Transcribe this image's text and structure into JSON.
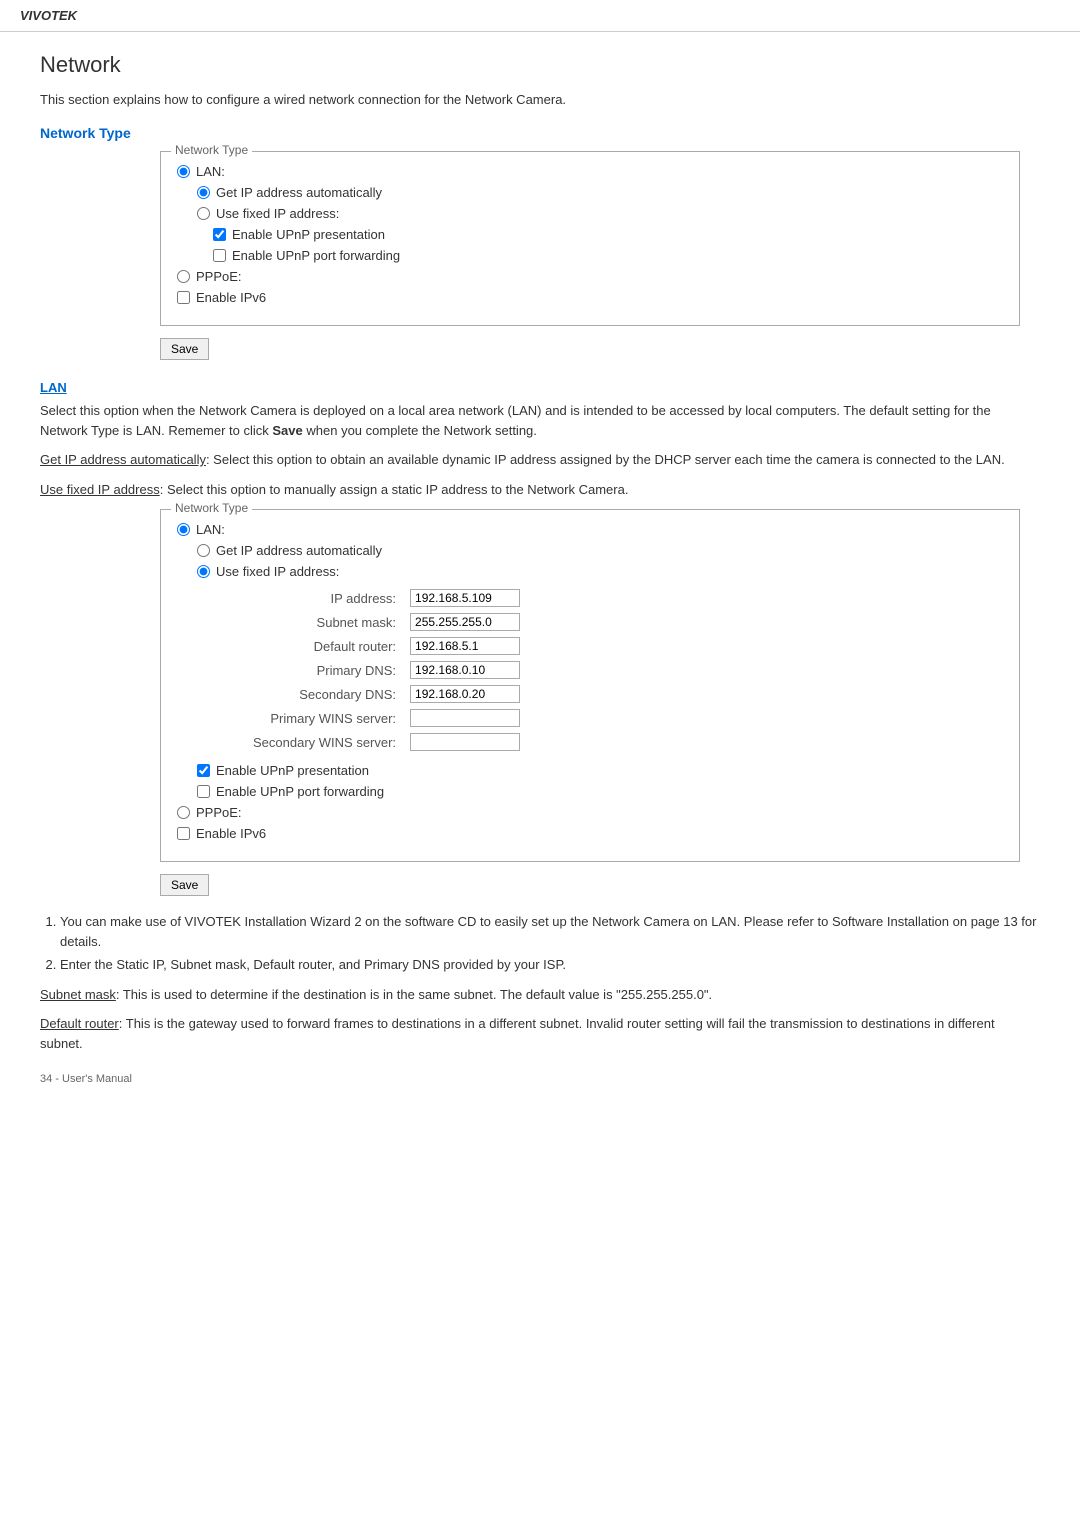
{
  "brand": "VIVOTEK",
  "page": {
    "title": "Network",
    "intro": "This section explains how to configure a wired network connection for the Network Camera."
  },
  "network_type_section": {
    "heading": "Network Type",
    "box_title": "Network Type",
    "box1": {
      "lan_label": "LAN:",
      "get_ip_auto_label": "Get IP address automatically",
      "use_fixed_ip_label": "Use fixed IP address:",
      "enable_upnp_pres_label": "Enable UPnP presentation",
      "enable_upnp_port_label": "Enable UPnP port forwarding",
      "pppoe_label": "PPPoE:",
      "enable_ipv6_label": "Enable IPv6"
    },
    "save_label": "Save"
  },
  "lan_section": {
    "heading": "LAN",
    "description": "Select this option when the Network Camera is deployed on a local area network (LAN) and is intended to be accessed by local computers. The default setting for the Network Type is LAN. Rememer to click Save when you complete the Network setting.",
    "get_ip_auto_text_label": "Get IP address automatically",
    "get_ip_auto_desc": ": Select this option to obtain an available dynamic IP address assigned by the DHCP server each time the camera is connected to the LAN.",
    "use_fixed_ip_text_label": "Use fixed IP address",
    "use_fixed_ip_desc": ": Select this option to manually assign a static IP address to the Network Camera."
  },
  "box2": {
    "box_title": "Network Type",
    "lan_label": "LAN:",
    "get_ip_auto_label": "Get IP address automatically",
    "use_fixed_ip_label": "Use fixed IP address:",
    "ip_address_label": "IP address:",
    "ip_address_value": "192.168.5.109",
    "subnet_mask_label": "Subnet mask:",
    "subnet_mask_value": "255.255.255.0",
    "default_router_label": "Default router:",
    "default_router_value": "192.168.5.1",
    "primary_dns_label": "Primary DNS:",
    "primary_dns_value": "192.168.0.10",
    "secondary_dns_label": "Secondary DNS:",
    "secondary_dns_value": "192.168.0.20",
    "primary_wins_label": "Primary WINS server:",
    "primary_wins_value": "",
    "secondary_wins_label": "Secondary WINS server:",
    "secondary_wins_value": "",
    "enable_upnp_pres_label": "Enable UPnP presentation",
    "enable_upnp_port_label": "Enable UPnP port forwarding",
    "pppoe_label": "PPPoE:",
    "enable_ipv6_label": "Enable IPv6"
  },
  "save2_label": "Save",
  "notes": {
    "item1": "You can make use of VIVOTEK Installation Wizard 2 on the software CD to easily set up the Network Camera on LAN. Please refer to Software Installation on page 13 for details.",
    "item2": "Enter the Static IP, Subnet mask, Default router, and Primary DNS provided by your ISP."
  },
  "subnet_mask_section": {
    "label": "Subnet mask",
    "text": ": This is used to determine if the destination is in the same subnet. The default value is \"255.255.255.0\"."
  },
  "default_router_section": {
    "label": "Default router",
    "text": ": This is the gateway used to forward frames to destinations in a different subnet. Invalid router setting will fail the transmission to destinations in different subnet."
  },
  "footer": "34 - User's Manual"
}
